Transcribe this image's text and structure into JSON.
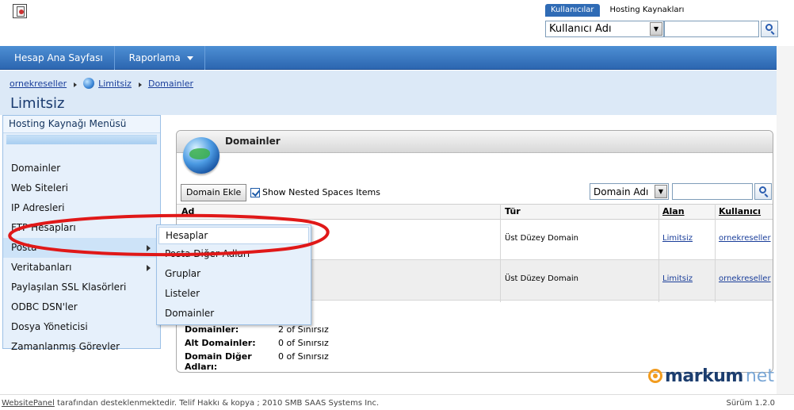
{
  "header": {
    "scope_tabs": [
      "Kullanıcılar",
      "Hosting Kaynakları"
    ],
    "search_field_value": "Kullanıcı Adı",
    "search_text": ""
  },
  "navbar": {
    "items": [
      "Hesap Ana Sayfası",
      "Raporlama"
    ]
  },
  "breadcrumb": [
    "ornekreseller",
    "Limitsiz",
    "Domainler"
  ],
  "page_title": "Limitsiz",
  "left_menu": {
    "title": "Hosting Kaynağı Menüsü",
    "items": [
      "Domainler",
      "Web Siteleri",
      "IP Adresleri",
      "FTP Hesapları",
      "Posta",
      "Veritabanları",
      "Paylaşılan SSL Klasörleri",
      "ODBC DSN'ler",
      "Dosya Yöneticisi",
      "Zamanlanmış Görevler"
    ]
  },
  "submenu": {
    "items": [
      "Hesaplar",
      "Posta Diğer Adları",
      "Gruplar",
      "Listeler",
      "Domainler"
    ]
  },
  "panel": {
    "title": "Domainler",
    "add_button": "Domain Ekle",
    "nested_checkbox_label": "Show Nested Spaces Items",
    "nested_checked": true,
    "filter_select": "Domain Adı",
    "filter_text": "",
    "columns": [
      "Ad",
      "Tür",
      "Alan",
      "Kullanıcı"
    ],
    "rows": [
      {
        "type": "Üst Düzey Domain",
        "space": "Limitsiz",
        "user": "ornekreseller"
      },
      {
        "type": "Üst Düzey Domain",
        "space": "Limitsiz",
        "user": "ornekreseller"
      }
    ],
    "summary": [
      {
        "label": "Domainler:",
        "value": "2 of Sınırsız"
      },
      {
        "label": "Alt Domainler:",
        "value": "0 of Sınırsız"
      },
      {
        "label": "Domain Diğer Adları:",
        "value": "0 of Sınırsız"
      }
    ]
  },
  "brand": {
    "part_a": "markum",
    "part_b": "net"
  },
  "footer": {
    "link": "WebsitePanel",
    "text": " tarafından desteklenmektedir. Telif Hakkı & kopya ; 2010 SMB SAAS Systems Inc.",
    "version": "Sürüm 1.2.0"
  },
  "colors": {
    "nav_blue": "#2c66b0",
    "annotation_red": "#e01818",
    "brand_orange": "#f29c1f"
  }
}
